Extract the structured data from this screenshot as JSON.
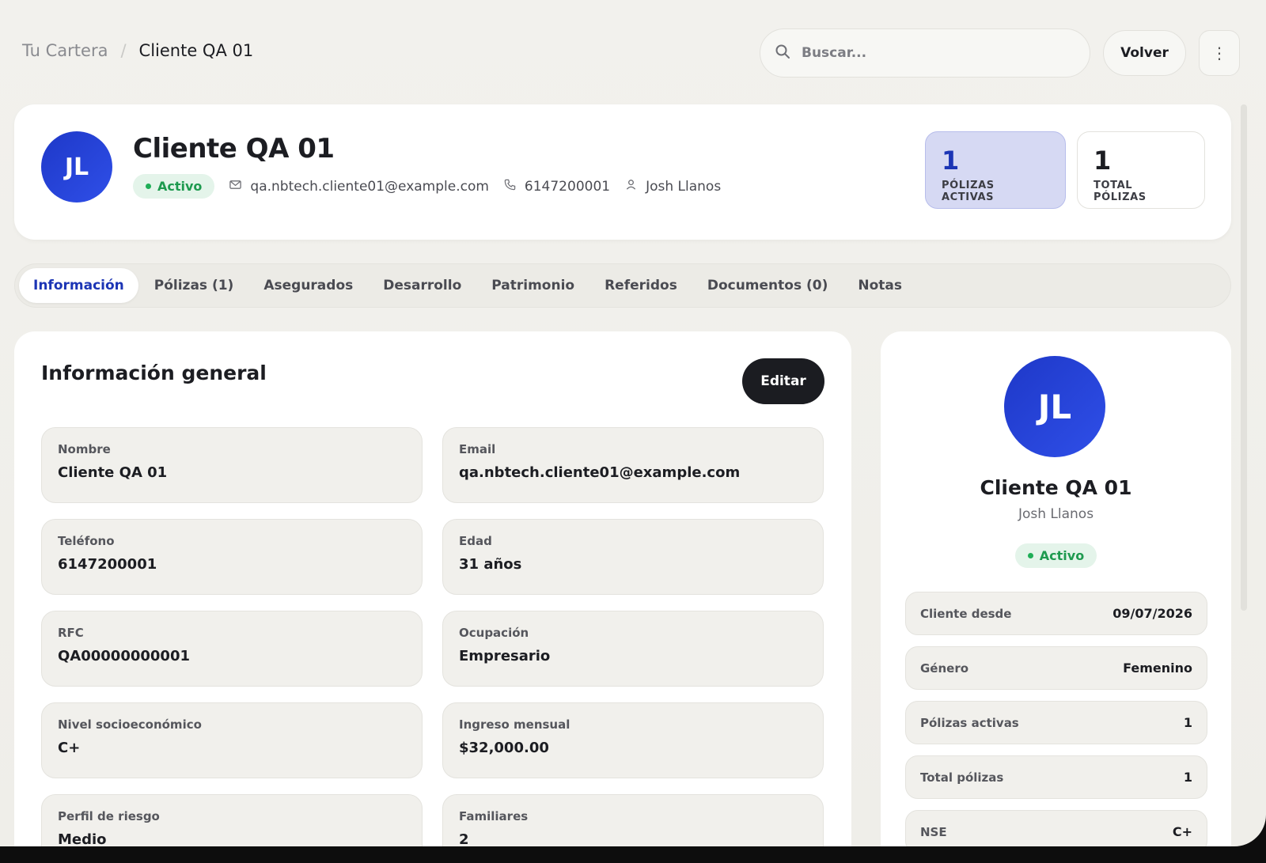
{
  "breadcrumb": {
    "parent": "Tu Cartera",
    "separator": "/",
    "current": "Cliente QA 01"
  },
  "search": {
    "placeholder": "Buscar..."
  },
  "topbar": {
    "back_label": "Volver",
    "more_icon": "⋮"
  },
  "client": {
    "initials": "JL",
    "name": "Cliente QA 01",
    "status": "Activo",
    "email": "qa.nbtech.cliente01@example.com",
    "phone": "6147200001",
    "agent": "Josh Llanos"
  },
  "stats": [
    {
      "value": "1",
      "label": "PÓLIZAS ACTIVAS"
    },
    {
      "value": "1",
      "label": "TOTAL PÓLIZAS"
    }
  ],
  "tabs": [
    {
      "label": "Información"
    },
    {
      "label": "Pólizas (1)"
    },
    {
      "label": "Asegurados"
    },
    {
      "label": "Desarrollo"
    },
    {
      "label": "Patrimonio"
    },
    {
      "label": "Referidos"
    },
    {
      "label": "Documentos (0)"
    },
    {
      "label": "Notas"
    }
  ],
  "info": {
    "title": "Información general",
    "edit_label": "Editar",
    "fields": [
      {
        "label": "Nombre",
        "value": "Cliente QA 01"
      },
      {
        "label": "Email",
        "value": "qa.nbtech.cliente01@example.com"
      },
      {
        "label": "Teléfono",
        "value": "6147200001"
      },
      {
        "label": "Edad",
        "value": "31 años"
      },
      {
        "label": "RFC",
        "value": "QA00000000001"
      },
      {
        "label": "Ocupación",
        "value": "Empresario"
      },
      {
        "label": "Nivel socioeconómico",
        "value": "C+"
      },
      {
        "label": "Ingreso mensual",
        "value": "$32,000.00"
      },
      {
        "label": "Perfil de riesgo",
        "value": "Medio"
      },
      {
        "label": "Familiares",
        "value": "2"
      }
    ]
  },
  "profile": {
    "initials": "JL",
    "name": "Cliente QA 01",
    "agent": "Josh Llanos",
    "status": "Activo",
    "details": [
      {
        "label": "Cliente desde",
        "value": "09/07/2026"
      },
      {
        "label": "Género",
        "value": "Femenino"
      },
      {
        "label": "Pólizas activas",
        "value": "1"
      },
      {
        "label": "Total pólizas",
        "value": "1"
      },
      {
        "label": "NSE",
        "value": "C+"
      }
    ]
  },
  "colors": {
    "accent": "#1c35b5",
    "active_green": "#1e9a4f",
    "dark_button": "#1b1c21"
  }
}
